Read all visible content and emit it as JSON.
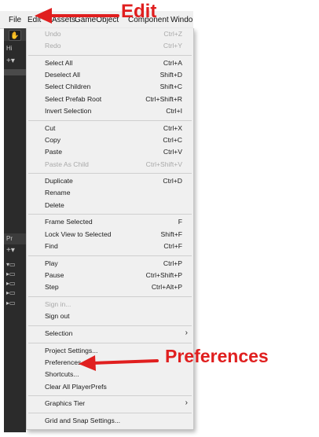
{
  "menubar": {
    "file": "File",
    "edit": "Edit",
    "assets": "Assets",
    "gameobject": "GameObject",
    "component": "Component",
    "window": "Windo"
  },
  "side_panels": {
    "hierarchy_label": "Hi",
    "plus_label": "+▾",
    "project_label": "Pr",
    "plus_label_2": "+▾"
  },
  "edit_menu": {
    "undo": {
      "label": "Undo",
      "shortcut": "Ctrl+Z"
    },
    "redo": {
      "label": "Redo",
      "shortcut": "Ctrl+Y"
    },
    "select_all": {
      "label": "Select All",
      "shortcut": "Ctrl+A"
    },
    "deselect_all": {
      "label": "Deselect All",
      "shortcut": "Shift+D"
    },
    "select_children": {
      "label": "Select Children",
      "shortcut": "Shift+C"
    },
    "select_prefab_root": {
      "label": "Select Prefab Root",
      "shortcut": "Ctrl+Shift+R"
    },
    "invert_selection": {
      "label": "Invert Selection",
      "shortcut": "Ctrl+I"
    },
    "cut": {
      "label": "Cut",
      "shortcut": "Ctrl+X"
    },
    "copy": {
      "label": "Copy",
      "shortcut": "Ctrl+C"
    },
    "paste": {
      "label": "Paste",
      "shortcut": "Ctrl+V"
    },
    "paste_as_child": {
      "label": "Paste As Child",
      "shortcut": "Ctrl+Shift+V"
    },
    "duplicate": {
      "label": "Duplicate",
      "shortcut": "Ctrl+D"
    },
    "rename": {
      "label": "Rename"
    },
    "delete": {
      "label": "Delete"
    },
    "frame_selected": {
      "label": "Frame Selected",
      "shortcut": "F"
    },
    "lock_view": {
      "label": "Lock View to Selected",
      "shortcut": "Shift+F"
    },
    "find": {
      "label": "Find",
      "shortcut": "Ctrl+F"
    },
    "play": {
      "label": "Play",
      "shortcut": "Ctrl+P"
    },
    "pause": {
      "label": "Pause",
      "shortcut": "Ctrl+Shift+P"
    },
    "step": {
      "label": "Step",
      "shortcut": "Ctrl+Alt+P"
    },
    "sign_in": {
      "label": "Sign in..."
    },
    "sign_out": {
      "label": "Sign out"
    },
    "selection": {
      "label": "Selection"
    },
    "project_settings": {
      "label": "Project Settings..."
    },
    "preferences": {
      "label": "Preferences..."
    },
    "shortcuts": {
      "label": "Shortcuts..."
    },
    "clear_playerprefs": {
      "label": "Clear All PlayerPrefs"
    },
    "graphics_tier": {
      "label": "Graphics Tier"
    },
    "grid_snap": {
      "label": "Grid and Snap Settings..."
    }
  },
  "annotations": {
    "edit_label": "Edit",
    "preferences_label": "Preferences",
    "color": "#e01f1f"
  }
}
